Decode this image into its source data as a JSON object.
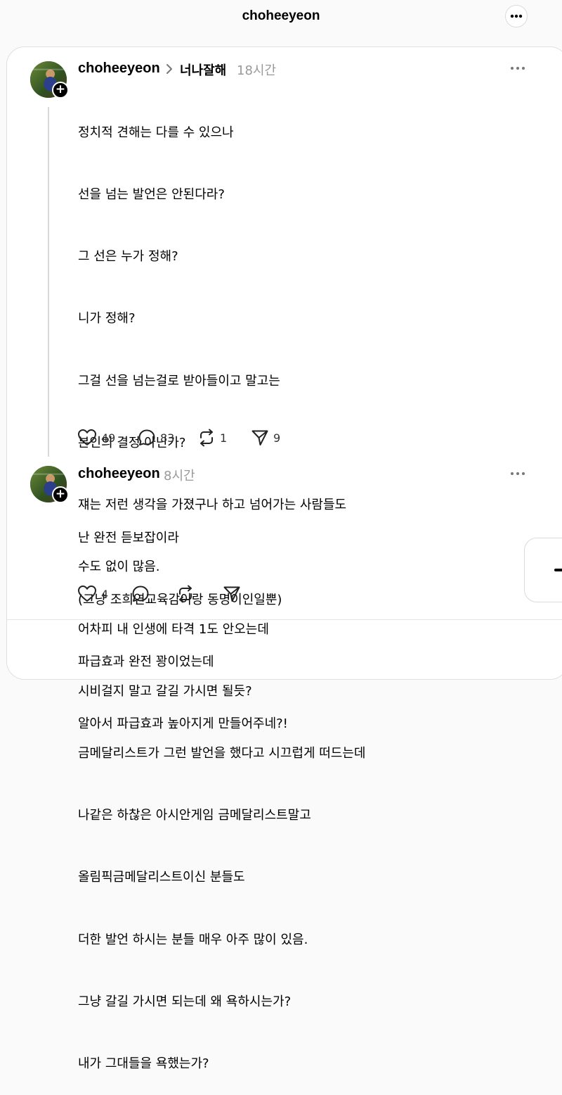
{
  "header": {
    "title": "choheeyeon",
    "more_icon": "ellipsis-icon"
  },
  "posts": [
    {
      "username": "choheeyeon",
      "reply_to": "너나잘해",
      "time": "18시간",
      "lines": [
        "정치적 견해는 다를 수 있으나",
        "선을 넘는 발언은 안된다라?",
        "그 선은 누가 정해?",
        "니가 정해?",
        "그걸 선을 넘는걸로 받아들이고 말고는",
        "본인의 결정 아닌가?",
        "쟤는 저런 생각을 가졌구나 하고 넘어가는 사람들도",
        "수도 없이 많음.",
        "어차피 내 인생에 타격 1도 안오는데",
        "시비걸지 말고 갈길 가시면 될듯?",
        "금메달리스트가 그런 발언을 했다고 시끄럽게 떠드는데",
        "나같은 하찮은 아시안게임 금메달리스트말고",
        "올림픽금메달리스트이신 분들도",
        "더한 발언 하시는 분들 매우 아주 많이 있음.",
        "그냥 갈길 가시면 되는데 왜 욕하시는가?",
        "내가 그대들을 욕했는가?"
      ],
      "likes": "49",
      "comments": "83",
      "reposts": "1",
      "shares": "9"
    },
    {
      "username": "choheeyeon",
      "time": "8시간",
      "lines": [
        "난 완전 듣보잡이라",
        "(그냥 조희연교육감이랑 동명이인일뿐)",
        "파급효과 완전 꽝이었는데",
        "알아서 파급효과 높아지게 만들어주네?!"
      ],
      "likes": "4",
      "comments": "",
      "reposts": "",
      "shares": ""
    }
  ],
  "icons": {
    "like": "heart-icon",
    "comment": "speech-bubble-icon",
    "repost": "repost-icon",
    "share": "send-icon",
    "follow": "plus-icon",
    "compose": "compose-icon"
  }
}
